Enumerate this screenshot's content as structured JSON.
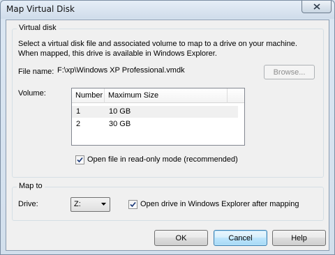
{
  "window": {
    "title": "Map Virtual Disk"
  },
  "virtual_disk": {
    "group_label": "Virtual disk",
    "description_line1": "Select a virtual disk file and associated volume to map to a drive on your machine.",
    "description_line2": "When mapped, this drive is available in Windows Explorer.",
    "file_name_label": "File name:",
    "file_name_value": "F:\\xp\\Windows XP Professional.vmdk",
    "browse_label": "Browse...",
    "volume_label": "Volume:",
    "columns": [
      "Number",
      "Maximum Size"
    ],
    "rows": [
      {
        "number": "1",
        "size": "10 GB",
        "selected": true
      },
      {
        "number": "2",
        "size": "30 GB",
        "selected": false
      }
    ],
    "readonly_label": "Open file in read-only mode (recommended)",
    "readonly_checked": true
  },
  "map_to": {
    "group_label": "Map to",
    "drive_label": "Drive:",
    "drive_value": "Z:",
    "open_explorer_label": "Open drive in Windows Explorer after mapping",
    "open_explorer_checked": true
  },
  "buttons": {
    "ok": "OK",
    "cancel": "Cancel",
    "help": "Help"
  },
  "icons": {
    "close": "close-icon",
    "check": "check-icon",
    "dropdown": "chevron-down-icon"
  }
}
